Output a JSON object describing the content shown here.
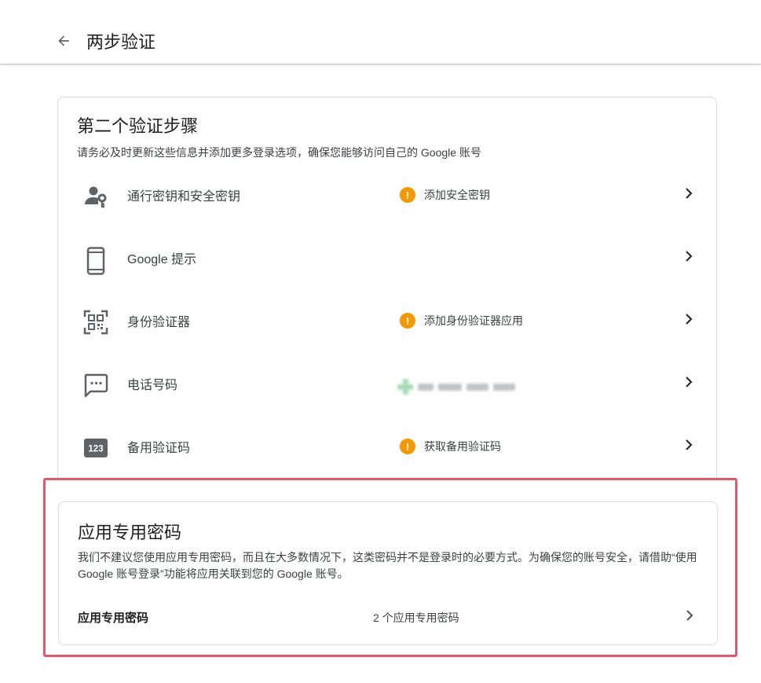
{
  "header": {
    "title": "两步验证",
    "back_icon": "arrow-left-icon"
  },
  "second_step": {
    "title": "第二个验证步骤",
    "description": "请务必及时更新这些信息并添加更多登录选项，确保您能够访问自己的 Google 账号",
    "methods": [
      {
        "label": "通行密钥和安全密钥",
        "icon": "passkey-person-key-icon",
        "status": "添加安全密钥",
        "status_icon": "warning-icon"
      },
      {
        "label": "Google 提示",
        "icon": "phone-icon",
        "status": ""
      },
      {
        "label": "身份验证器",
        "icon": "qr-code-icon",
        "status": "添加身份验证器应用",
        "status_icon": "warning-icon"
      },
      {
        "label": "电话号码",
        "icon": "sms-icon",
        "status": "",
        "status_note": "blurred phone number"
      },
      {
        "label": "备用验证码",
        "icon": "backup-codes-123-icon",
        "icon_text": "123",
        "status": "获取备用验证码",
        "status_icon": "warning-icon"
      }
    ]
  },
  "app_passwords": {
    "title": "应用专用密码",
    "description": "我们不建议您使用应用专用密码，而且在大多数情况下，这类密码并不是登录时的必要方式。为确保您的账号安全，请借助“使用 Google 账号登录”功能将应用关联到您的 Google 账号。",
    "row_label": "应用专用密码",
    "row_value": "2 个应用专用密码"
  },
  "colors": {
    "warning": "#f29900",
    "highlight_border": "#e8566a",
    "text_primary": "#202124",
    "text_secondary": "#3c4043",
    "icon_gray": "#5f6368"
  }
}
